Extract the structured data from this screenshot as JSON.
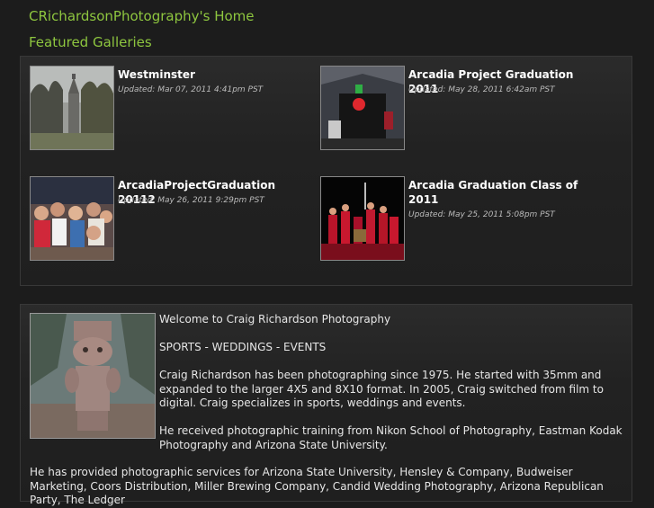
{
  "site": {
    "title": "CRichardsonPhotography's Home"
  },
  "featured": {
    "heading": "Featured Galleries",
    "galleries": [
      {
        "title": "Westminster",
        "updated": "Updated: Mar 07, 2011 4:41pm PST"
      },
      {
        "title": "Arcadia Project Graduation 2011",
        "updated": "Updated: May 28, 2011 6:42am PST"
      },
      {
        "title": "ArcadiaProjectGraduation 20112",
        "updated": "Updated: May 26, 2011 9:29pm PST"
      },
      {
        "title": "Arcadia Graduation Class of 2011",
        "updated": "Updated: May 25, 2011 5:08pm PST"
      }
    ]
  },
  "welcome": {
    "intro": "Welcome to Craig Richardson Photography",
    "tagline": "SPORTS - WEDDINGS - EVENTS",
    "para1": "Craig Richardson has been photographing since 1975. He started with 35mm and expanded to the larger 4X5 and 8X10 format. In 2005, Craig switched from film to digital. Craig specializes in sports, weddings and events.",
    "para2": "He received photographic training from Nikon School of Photography, Eastman Kodak Photography and Arizona State University.",
    "para3": "He has provided photographic services for Arizona State University, Hensley & Company, Budweiser Marketing, Coors Distribution, Miller Brewing Company, Candid Wedding Photography, Arizona Republican Party, The Ledger"
  }
}
